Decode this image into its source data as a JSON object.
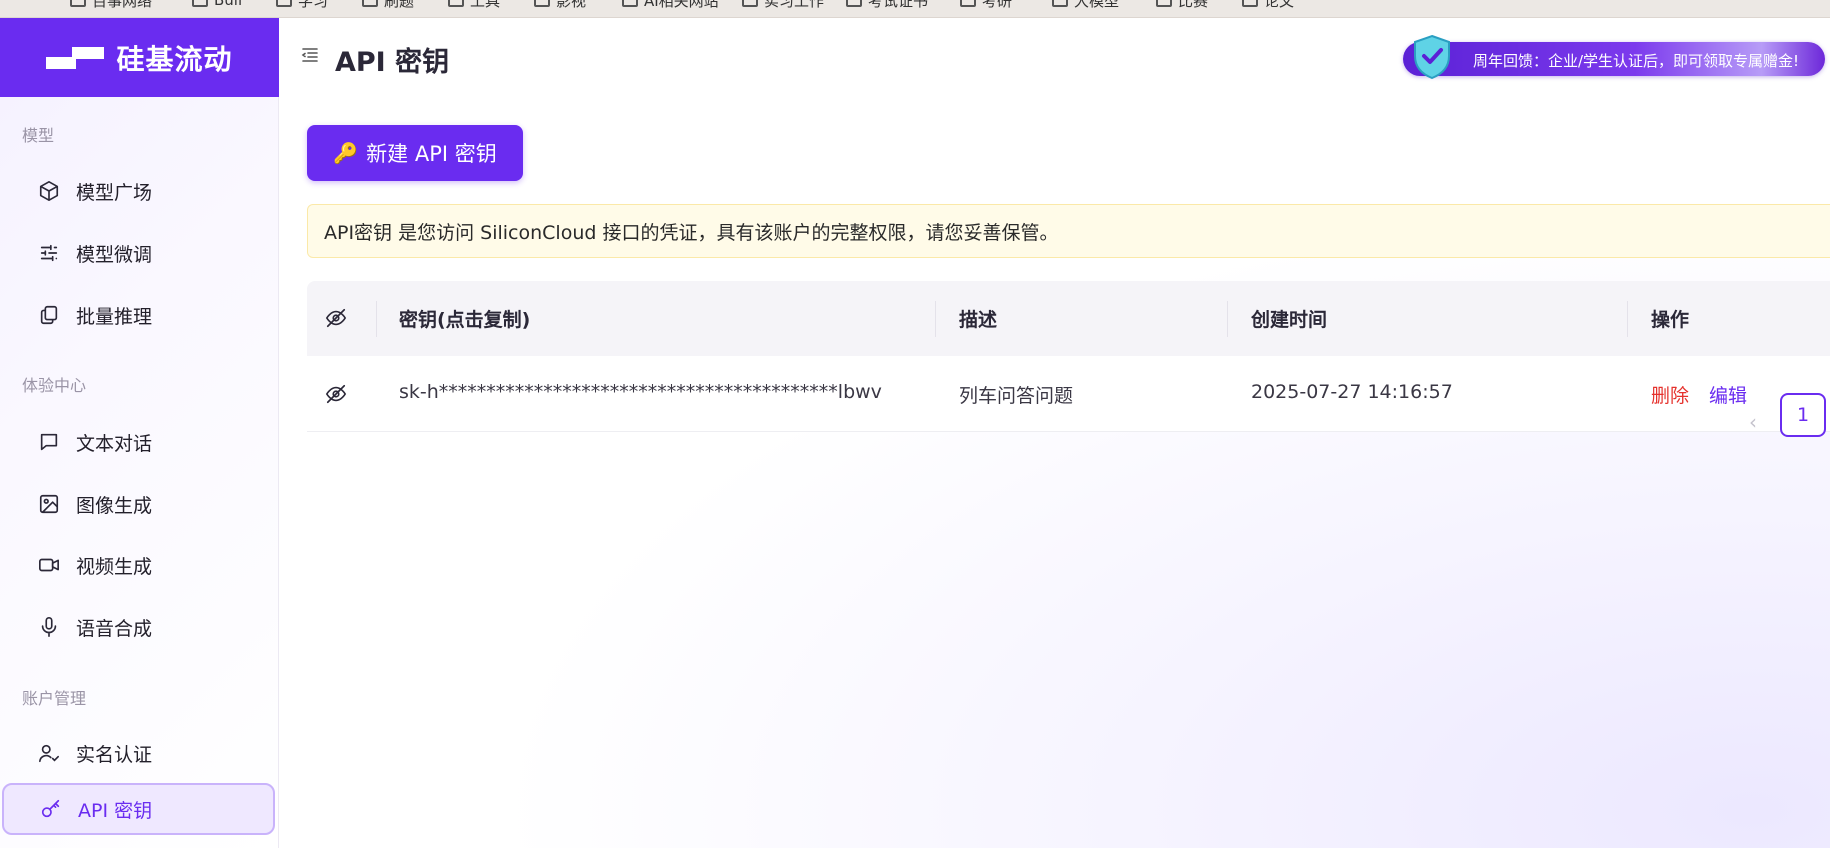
{
  "bookmarks": [
    "百事网络",
    "Bull",
    "学习",
    "刷题",
    "工具",
    "影视",
    "AI相关网站",
    "实习工作",
    "考试证书",
    "考研",
    "大模型",
    "比赛",
    "论文"
  ],
  "brand": {
    "name": "硅基流动"
  },
  "sidebar": {
    "sections": [
      {
        "label": "模型"
      },
      {
        "label": "体验中心"
      },
      {
        "label": "账户管理"
      }
    ],
    "items": [
      {
        "label": "模型广场",
        "icon": "cube-icon"
      },
      {
        "label": "模型微调",
        "icon": "sliders-icon"
      },
      {
        "label": "批量推理",
        "icon": "copy-icon"
      },
      {
        "label": "文本对话",
        "icon": "chat-icon"
      },
      {
        "label": "图像生成",
        "icon": "image-icon"
      },
      {
        "label": "视频生成",
        "icon": "video-icon"
      },
      {
        "label": "语音合成",
        "icon": "mic-icon"
      },
      {
        "label": "实名认证",
        "icon": "user-check-icon"
      },
      {
        "label": "API 密钥",
        "icon": "key-icon",
        "active": true
      }
    ]
  },
  "header": {
    "title": "API 密钥",
    "promo_text": "周年回馈：企业/学生认证后，即可领取专属赠金!"
  },
  "main": {
    "create_button_label": "新建 API 密钥",
    "notice": "API密钥 是您访问 SiliconCloud 接口的凭证，具有该账户的完整权限，请您妥善保管。",
    "table": {
      "columns": [
        "密钥(点击复制)",
        "描述",
        "创建时间",
        "操作"
      ],
      "rows": [
        {
          "key": "sk-h******************************************lbwv",
          "description": "列车问答问题",
          "created_at": "2025-07-27 14:16:57",
          "actions": {
            "delete": "删除",
            "edit": "编辑"
          }
        }
      ]
    },
    "pagination": {
      "current_page": "1"
    }
  },
  "colors": {
    "accent": "#6a2cf0",
    "danger": "#e5322d",
    "notice_bg": "#fffbe8"
  }
}
